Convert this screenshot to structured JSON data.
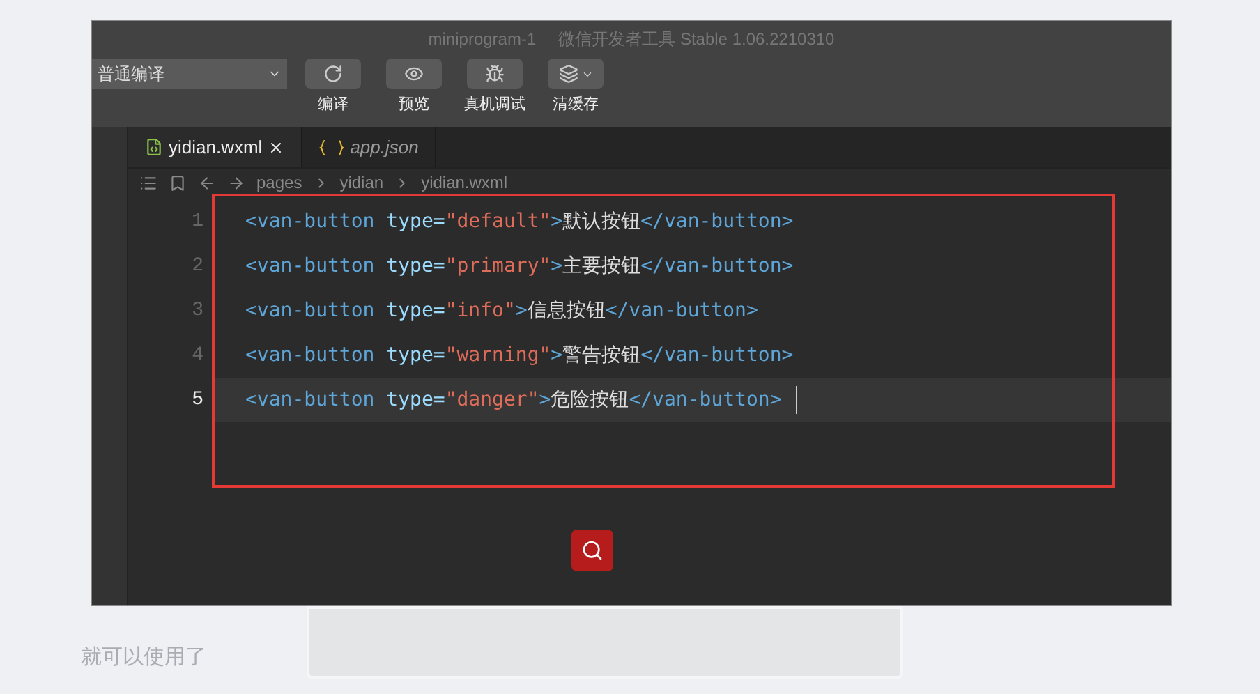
{
  "window": {
    "title": "miniprogram-1",
    "subtitle": "微信开发者工具 Stable 1.06.2210310"
  },
  "toolbar": {
    "compile_mode": "普通编译",
    "buttons": [
      {
        "kind": "refresh",
        "label": "编译"
      },
      {
        "kind": "preview",
        "label": "预览"
      },
      {
        "kind": "debug",
        "label": "真机调试"
      },
      {
        "kind": "cache",
        "label": "清缓存"
      }
    ]
  },
  "tabs": [
    {
      "label": "yidian.wxml",
      "kind": "wxml",
      "selected": true
    },
    {
      "label": "app.json",
      "kind": "json",
      "selected": false
    }
  ],
  "breadcrumb": [
    "pages",
    "yidian",
    "yidian.wxml"
  ],
  "code_lines": [
    {
      "number": "1",
      "selected": false,
      "tokens": [
        {
          "kind": "tag",
          "text": "<van-button "
        },
        {
          "kind": "attr",
          "text": "type="
        },
        {
          "kind": "value",
          "text": "\"default\""
        },
        {
          "kind": "tag",
          "text": ">"
        },
        {
          "kind": "text",
          "text": "默认按钮"
        },
        {
          "kind": "tag",
          "text": "</van-button>"
        }
      ]
    },
    {
      "number": "2",
      "selected": false,
      "tokens": [
        {
          "kind": "tag",
          "text": "<van-button "
        },
        {
          "kind": "attr",
          "text": "type="
        },
        {
          "kind": "value",
          "text": "\"primary\""
        },
        {
          "kind": "tag",
          "text": ">"
        },
        {
          "kind": "text",
          "text": "主要按钮"
        },
        {
          "kind": "tag",
          "text": "</van-button>"
        }
      ]
    },
    {
      "number": "3",
      "selected": false,
      "tokens": [
        {
          "kind": "tag",
          "text": "<van-button "
        },
        {
          "kind": "attr",
          "text": "type="
        },
        {
          "kind": "value",
          "text": "\"info\""
        },
        {
          "kind": "tag",
          "text": ">"
        },
        {
          "kind": "text",
          "text": "信息按钮"
        },
        {
          "kind": "tag",
          "text": "</van-button>"
        }
      ]
    },
    {
      "number": "4",
      "selected": false,
      "tokens": [
        {
          "kind": "tag",
          "text": "<van-button "
        },
        {
          "kind": "attr",
          "text": "type="
        },
        {
          "kind": "value",
          "text": "\"warning\""
        },
        {
          "kind": "tag",
          "text": ">"
        },
        {
          "kind": "text",
          "text": "警告按钮"
        },
        {
          "kind": "tag",
          "text": "</van-button>"
        }
      ]
    },
    {
      "number": "5",
      "selected": true,
      "tokens": [
        {
          "kind": "tag",
          "text": "<van-button "
        },
        {
          "kind": "attr",
          "text": "type="
        },
        {
          "kind": "value",
          "text": "\"danger\""
        },
        {
          "kind": "tag",
          "text": ">"
        },
        {
          "kind": "text",
          "text": "危险按钮"
        },
        {
          "kind": "tag",
          "text": "</van-button>"
        }
      ]
    }
  ],
  "page_text": "就可以使用了"
}
